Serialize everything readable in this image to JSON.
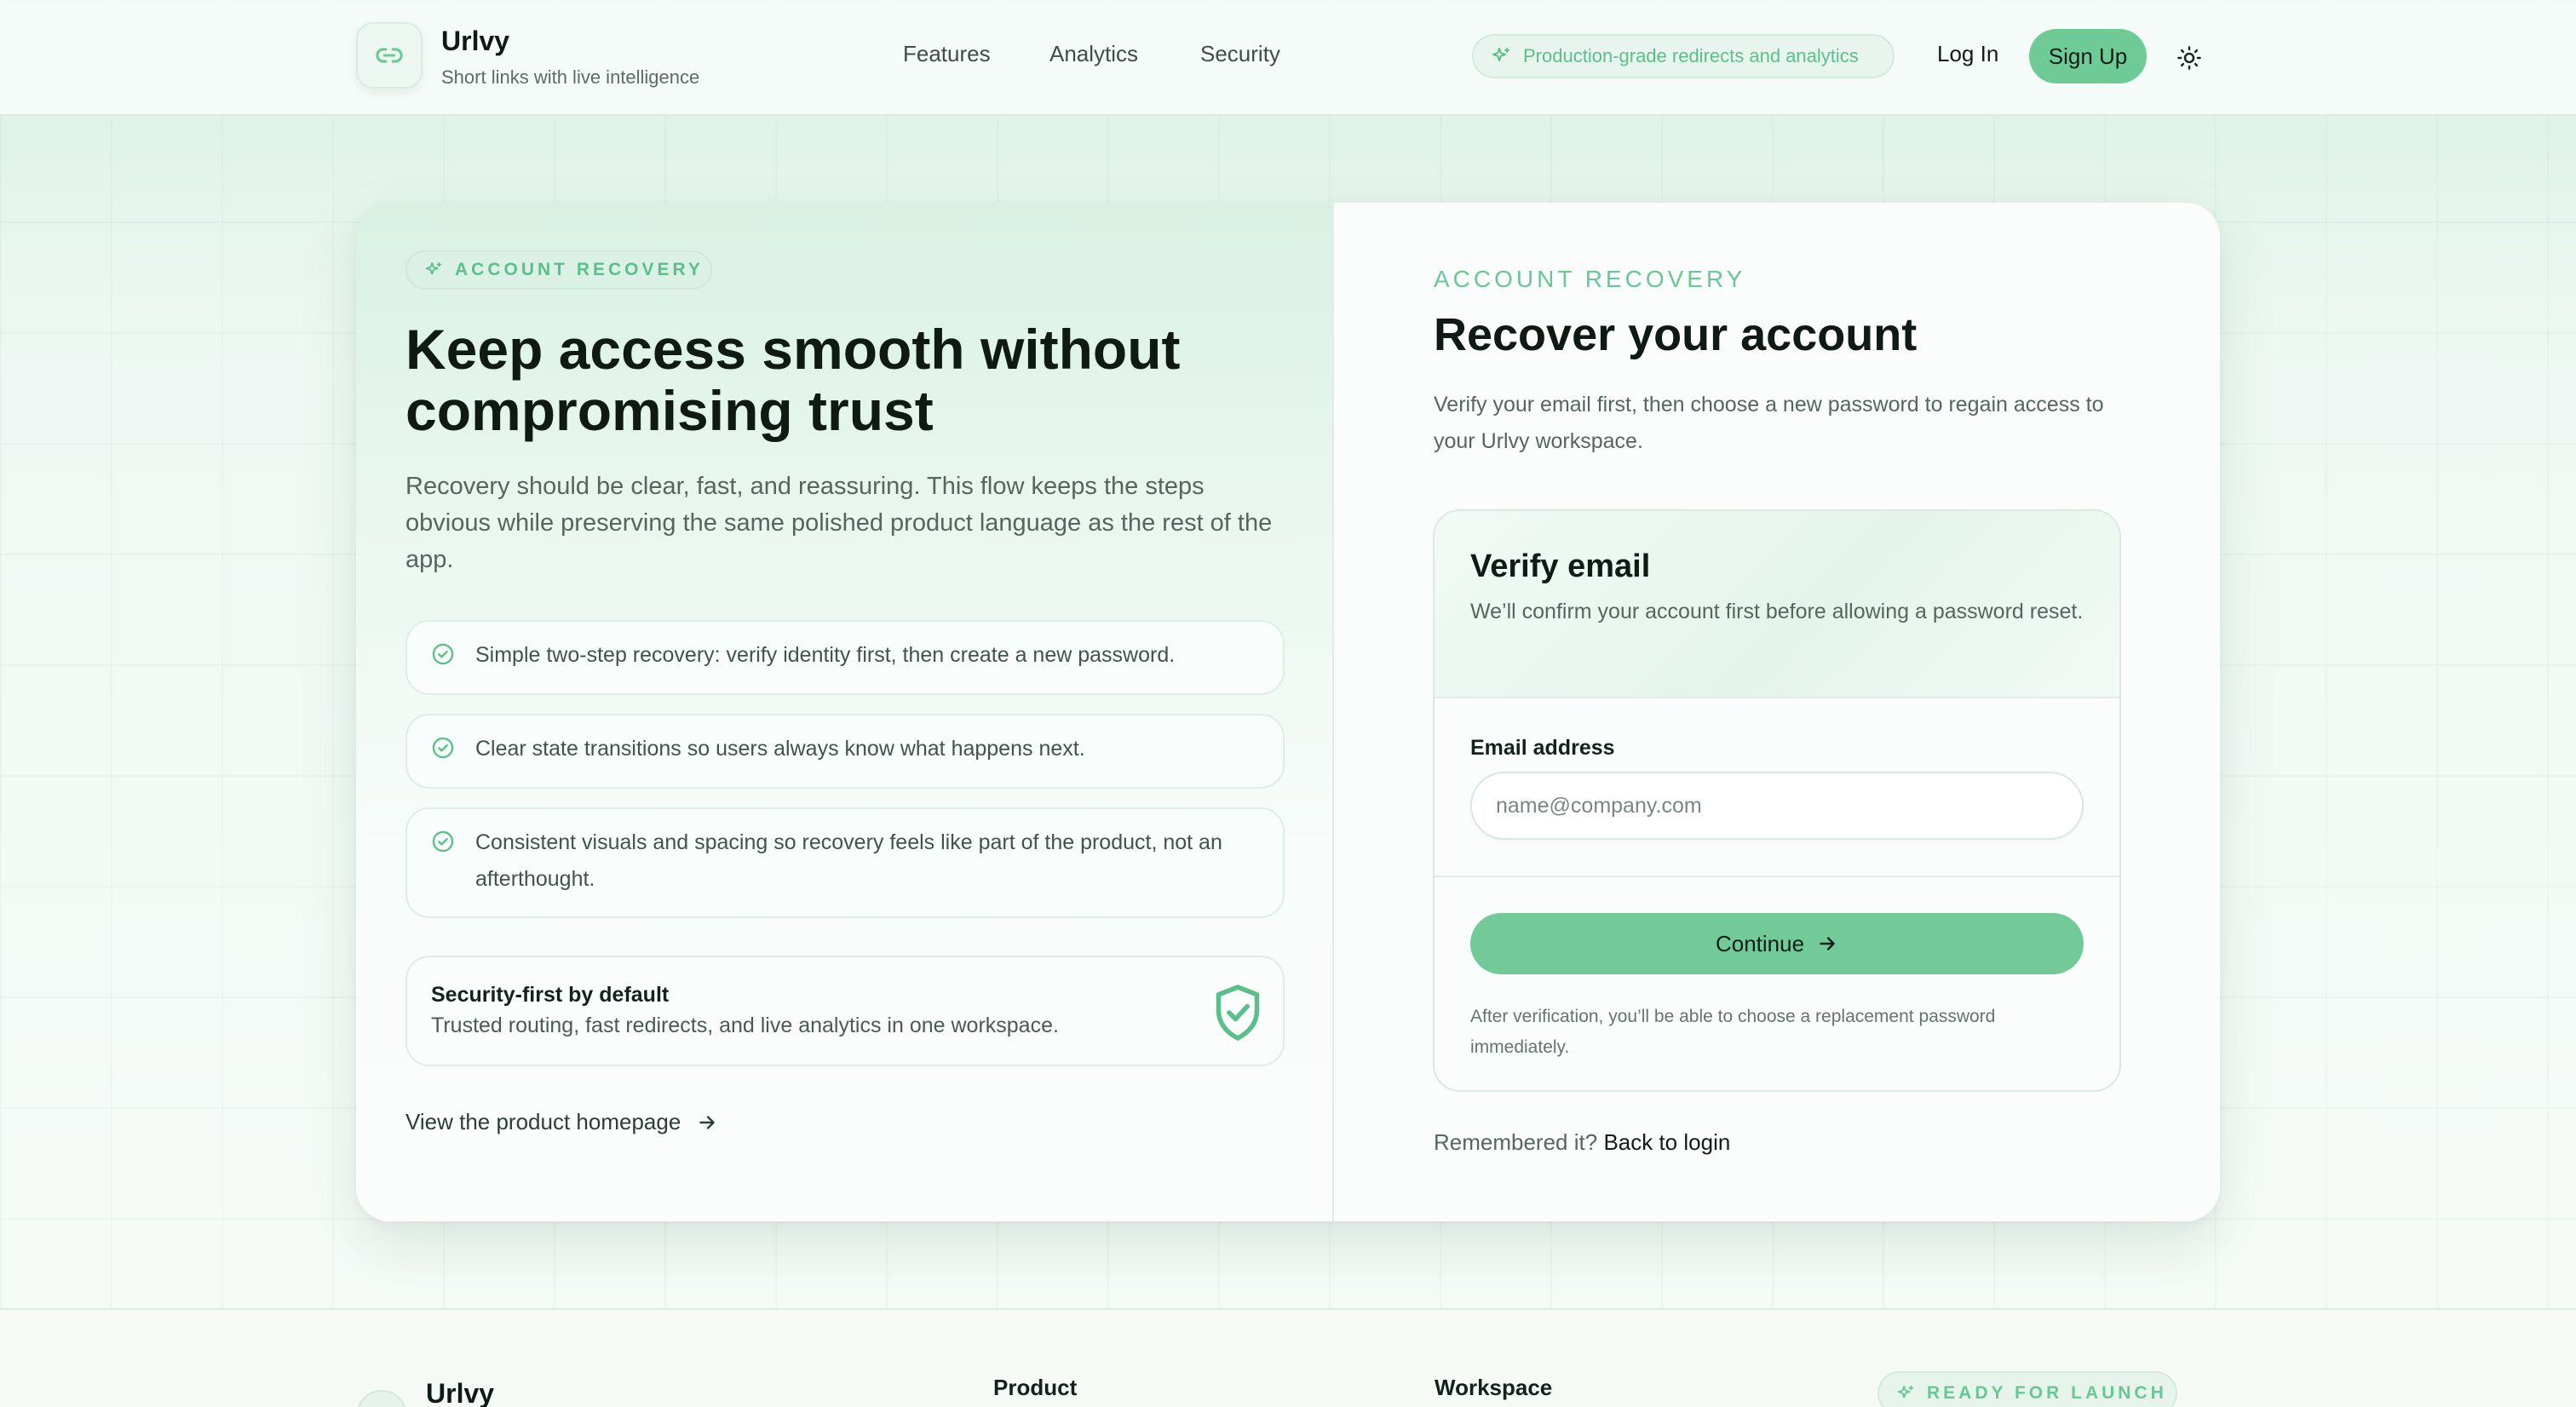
{
  "header": {
    "brand_name": "Urlvy",
    "brand_tagline": "Short links with live intelligence",
    "nav": [
      "Features",
      "Analytics",
      "Security"
    ],
    "badge": "Production-grade redirects and analytics",
    "login": "Log In",
    "signup": "Sign Up"
  },
  "left": {
    "eyebrow": "ACCOUNT RECOVERY",
    "title": "Keep access smooth without compromising trust",
    "subtitle": "Recovery should be clear, fast, and reassuring. This flow keeps the steps obvious while preserving the same polished product language as the rest of the app.",
    "features": [
      "Simple two-step recovery: verify identity first, then create a new password.",
      "Clear state transitions so users always know what happens next.",
      "Consistent visuals and spacing so recovery feels like part of the product, not an afterthought."
    ],
    "security_title": "Security-first by default",
    "security_desc": "Trusted routing, fast redirects, and live analytics in one workspace.",
    "homepage_link": "View the product homepage"
  },
  "right": {
    "eyebrow": "ACCOUNT RECOVERY",
    "title": "Recover your account",
    "subtitle": "Verify your email first, then choose a new password to regain access to your Urlvy workspace.",
    "form": {
      "title": "Verify email",
      "description": "We’ll confirm your account first before allowing a password reset.",
      "email_label": "Email address",
      "email_placeholder": "name@company.com",
      "continue_label": "Continue",
      "note": "After verification, you’ll be able to choose a replacement password immediately."
    },
    "remember_prefix": "Remembered it?",
    "back_to_login": "Back to login"
  },
  "footer": {
    "brand_name": "Urlvy",
    "col_product": "Product",
    "col_workspace": "Workspace",
    "badge": "READY FOR LAUNCH"
  },
  "colors": {
    "accent": "#6fcb96",
    "accent_text": "#5cbf8b",
    "text": "#15211b"
  },
  "icons": {
    "logo": "link-icon",
    "badge": "sparkle-icon",
    "theme": "sun-icon",
    "check": "check-circle-icon",
    "shield": "shield-check-icon",
    "arrow": "arrow-right-icon"
  }
}
